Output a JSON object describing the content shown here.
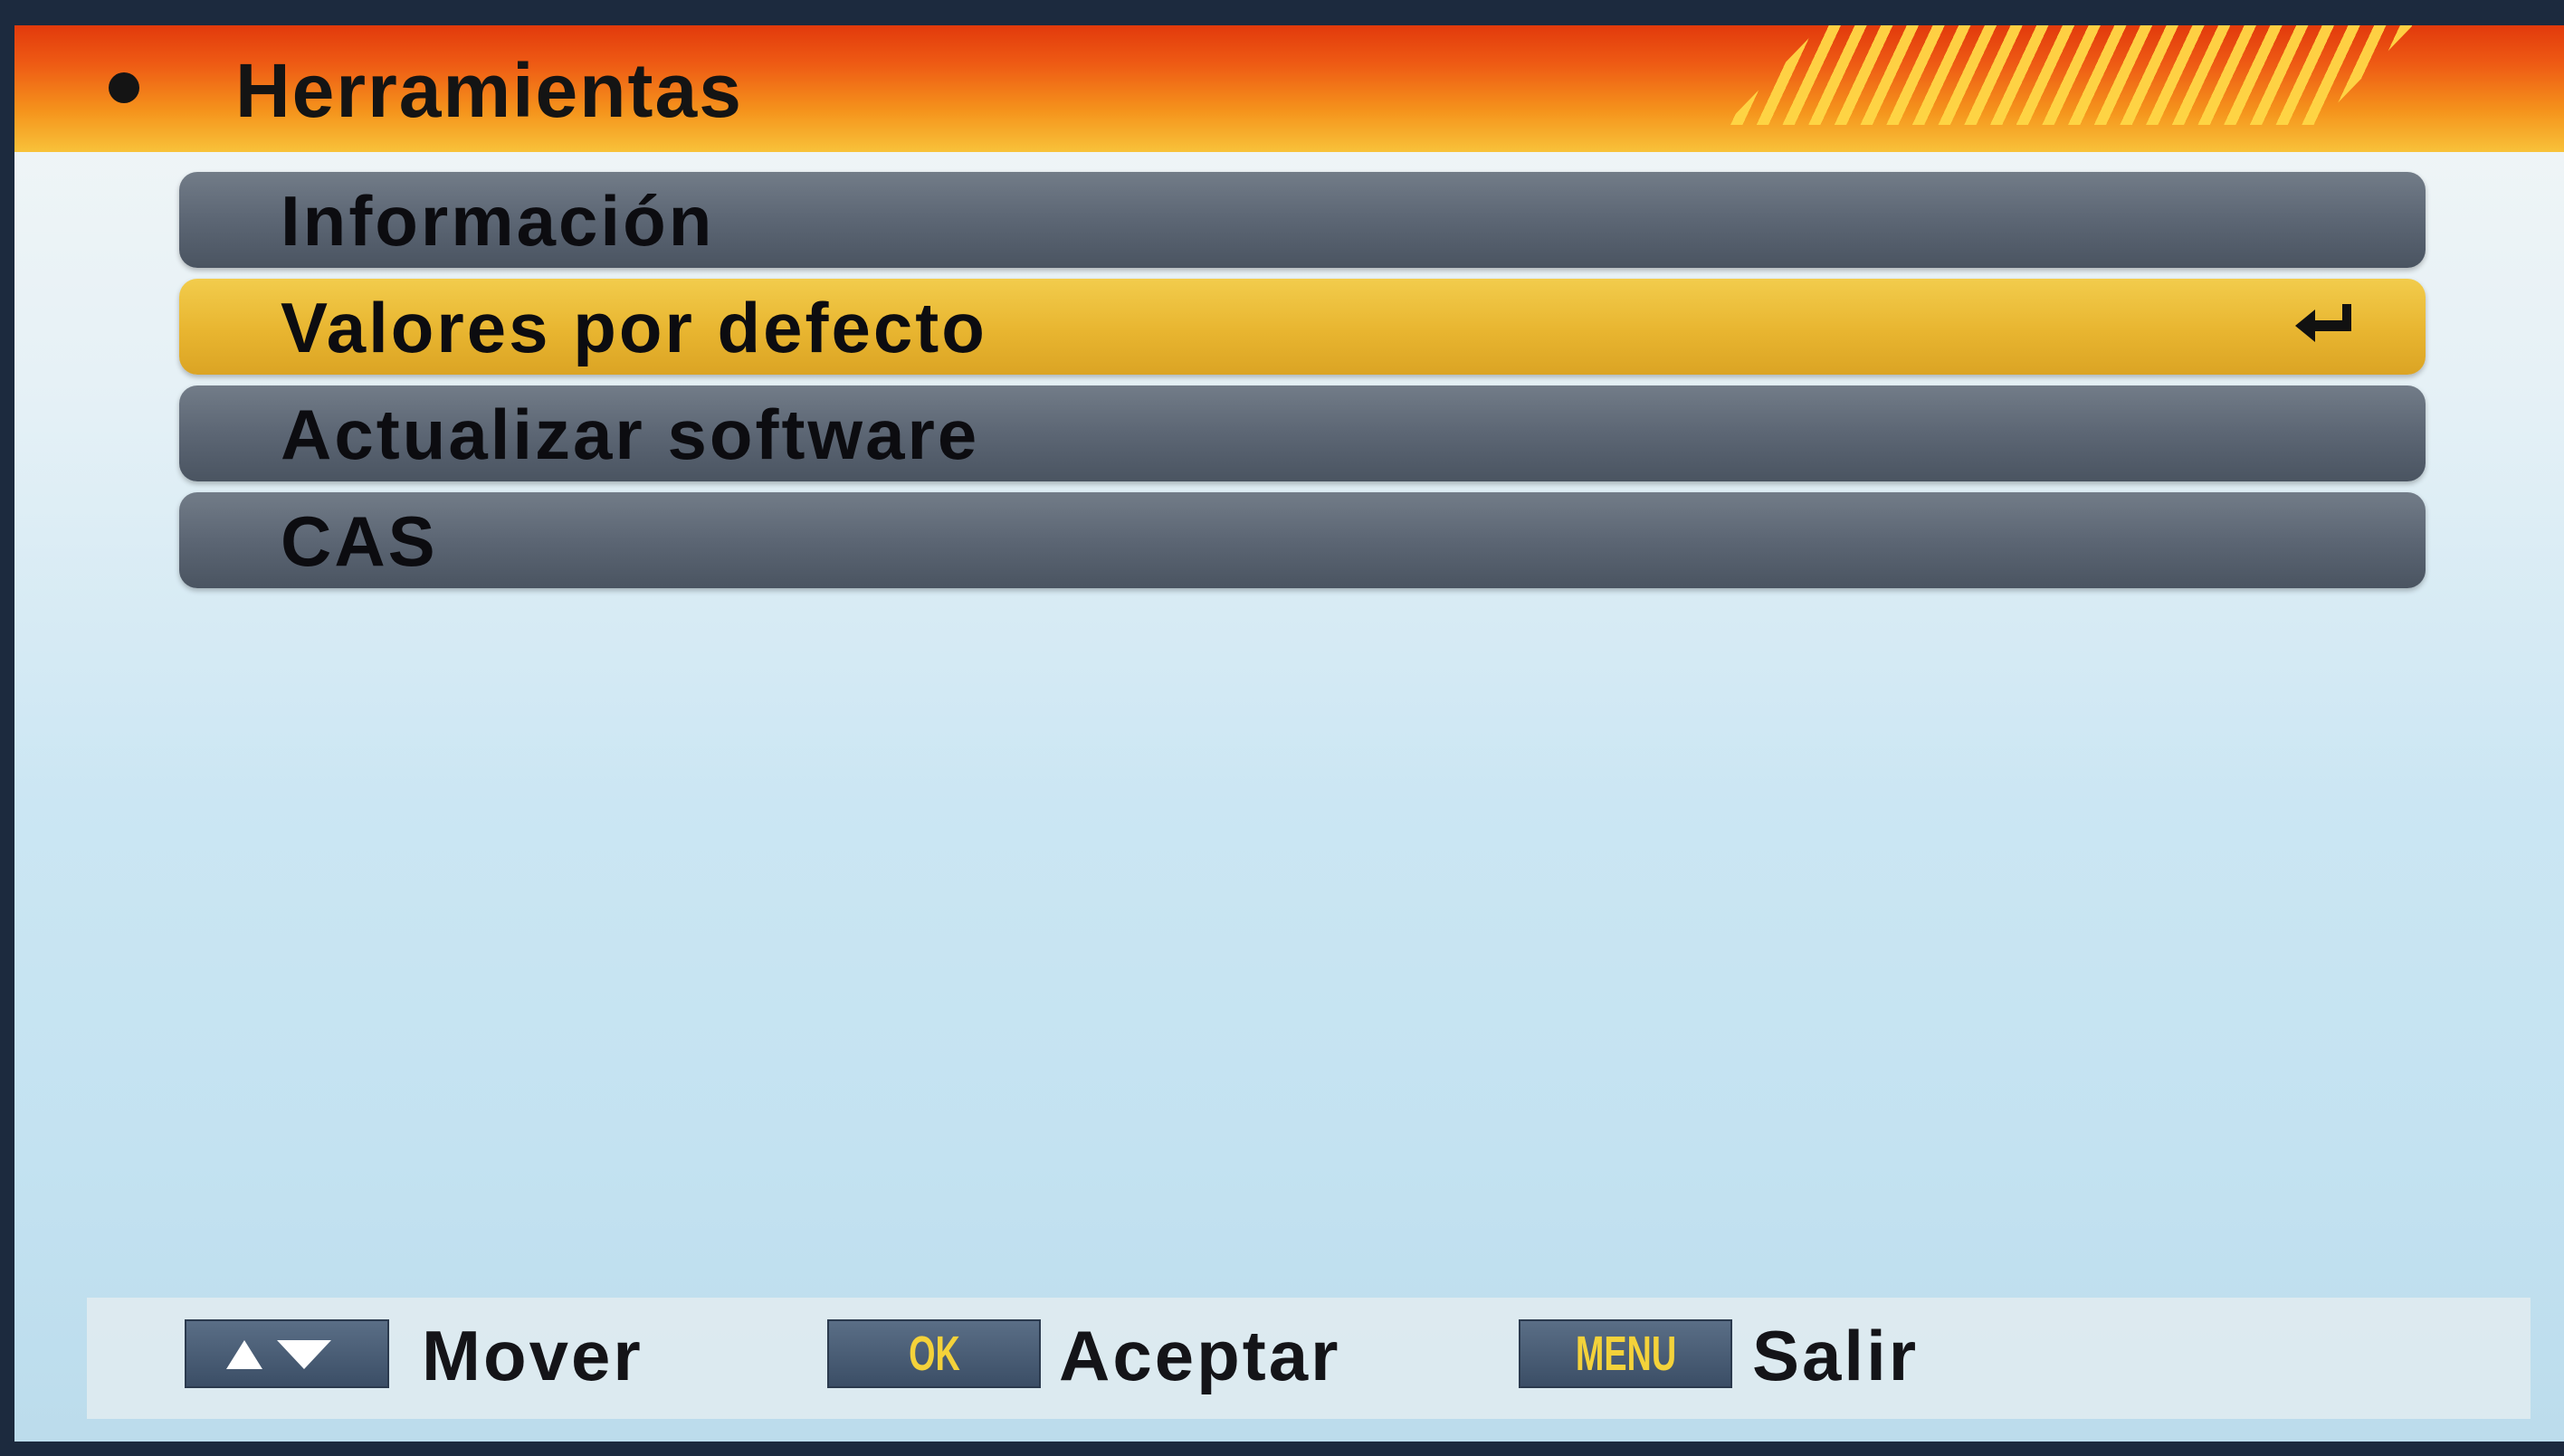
{
  "header": {
    "title": "Herramientas"
  },
  "menu": {
    "items": [
      {
        "label": "Información"
      },
      {
        "label": "Valores por defecto"
      },
      {
        "label": "Actualizar software"
      },
      {
        "label": "CAS"
      }
    ],
    "selected_index": 1
  },
  "footer": {
    "move_key_icon": "up-down-arrows-icon",
    "move_label": "Mover",
    "ok_key": "OK",
    "ok_label": "Aceptar",
    "menu_key": "MENU",
    "menu_label": "Salir"
  },
  "colors": {
    "header_red": "#e23a0c",
    "header_orange": "#f5941c",
    "selected_yellow": "#e8b530",
    "item_gray": "#5c6674",
    "background_light_blue": "#c3e2f1",
    "key_text_yellow": "#f4d23a"
  }
}
